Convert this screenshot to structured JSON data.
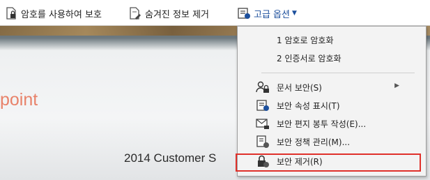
{
  "toolbar": {
    "items": [
      {
        "label": "암호를 사용하여 보호",
        "icon": "lock-document-icon"
      },
      {
        "label": "숨겨진 정보 제거",
        "icon": "remove-info-icon"
      },
      {
        "label": "고급 옵션",
        "icon": "advanced-options-icon"
      }
    ]
  },
  "document": {
    "fragment": "point",
    "subtitle": "2014 Customer S"
  },
  "menu": {
    "items": [
      {
        "label": "1 암호로 암호화"
      },
      {
        "label": "2 인증서로 암호화"
      },
      {
        "label": "문서 보안(S)",
        "icon": "users-lock-icon",
        "submenu": true
      },
      {
        "label": "보안 속성 표시(T)",
        "icon": "security-props-icon"
      },
      {
        "label": "보안 편지 봉투 작성(E)...",
        "icon": "envelope-lock-icon"
      },
      {
        "label": "보안 정책 관리(M)...",
        "icon": "policy-icon"
      },
      {
        "label": "보안 제거(R)",
        "icon": "remove-security-icon",
        "highlighted": true
      }
    ]
  },
  "colors": {
    "accent": "#1c4f9c",
    "highlight_border": "#e0302a"
  }
}
